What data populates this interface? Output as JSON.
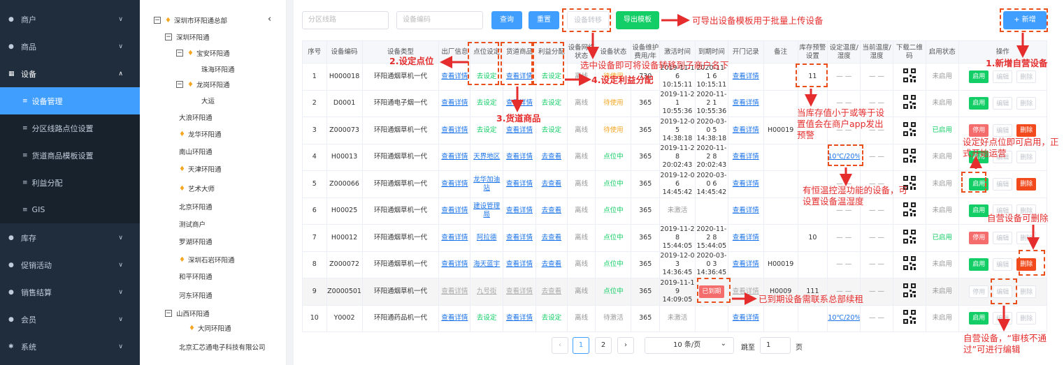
{
  "sidebar": {
    "items": [
      {
        "label": "商户",
        "icon": "merchant-icon",
        "chevron": "∨"
      },
      {
        "label": "商品",
        "icon": "goods-icon",
        "chevron": "∨"
      },
      {
        "label": "设备",
        "icon": "device-icon",
        "chevron": "∧"
      },
      {
        "label": "库存",
        "icon": "stock-icon",
        "chevron": "∨"
      },
      {
        "label": "促销活动",
        "icon": "promo-icon",
        "chevron": "∨"
      },
      {
        "label": "销售结算",
        "icon": "settlement-icon",
        "chevron": "∨"
      },
      {
        "label": "会员",
        "icon": "member-icon",
        "chevron": "∨"
      },
      {
        "label": "系统",
        "icon": "system-icon",
        "chevron": "∨"
      }
    ],
    "sub_items": [
      "设备管理",
      "分区线路点位设置",
      "货道商品模板设置",
      "利益分配",
      "GIS"
    ],
    "active_color": "#409eff",
    "bg_color": "#1f2d3d"
  },
  "tree": {
    "nodes": [
      "深圳市环阳通总部",
      "深圳环阳通",
      "宝安环阳通",
      "珠海环阳通",
      "龙岗环阳通",
      "大运",
      "大浪环阳通",
      "龙华环阳通",
      "南山环阳通",
      "天津环阳通",
      "艺术大师",
      "北京环阳通",
      "测试商户",
      "罗湖环阳通",
      "深圳石岩环阳通",
      "和平环阳通",
      "河东环阳通",
      "山西环阳通",
      "大同环阳通",
      "北京汇芯通电子科技有限公司"
    ],
    "collapse_icon": "‹"
  },
  "toolbar": {
    "zone_placeholder": "分区线路",
    "code_placeholder": "设备编码",
    "query": "查询",
    "reset": "重置",
    "transfer": "设备转移",
    "export": "导出模板",
    "add": "+ 新增"
  },
  "table": {
    "headers": [
      "序号",
      "设备编码",
      "设备类型",
      "出厂信息",
      "点位设定",
      "货道商品",
      "利益分配",
      "设备网络状态",
      "设备状态",
      "设备维护费用/年",
      "激活时间",
      "到期时间",
      "开门记录",
      "备注",
      "库存预警设置",
      "设定温度/湿度",
      "当前温度/湿度",
      "下载二维码",
      "启用状态",
      "操作"
    ],
    "rows": [
      {
        "no": "1",
        "code": "H000018",
        "type": "环阳通烟草机一代",
        "factory": "查看详情",
        "point": "去设定",
        "goods": "查看详情",
        "profit": "去设定",
        "net": "离线",
        "status": "待使用",
        "fee": "730",
        "active": "2019-11-1 6 10:15:11",
        "expire": "2020-11-1 6 10:15:11",
        "door": "查看详情",
        "note": "",
        "warn": "11",
        "settemp": "— —",
        "curtemp": "— —",
        "enabled": "未启用",
        "op1": "启用",
        "op2": "编辑",
        "op3": "删除"
      },
      {
        "no": "2",
        "code": "D0001",
        "type": "环阳通电子烟一代",
        "factory": "查看详情",
        "point": "去设定",
        "goods": "查看详情",
        "profit": "去设定",
        "net": "离线",
        "status": "待使用",
        "fee": "365",
        "active": "2019-11-2 1 10:55:36",
        "expire": "2020-11-2 1 10:55:36",
        "door": "查看详情",
        "note": "",
        "warn": "",
        "settemp": "— —",
        "curtemp": "— —",
        "enabled": "未启用",
        "op1": "启用",
        "op2": "编辑",
        "op3": "删除"
      },
      {
        "no": "3",
        "code": "Z000073",
        "type": "环阳通烟草机一代",
        "factory": "查看详情",
        "point": "去设定",
        "goods": "查看详情",
        "profit": "去设定",
        "net": "离线",
        "status": "待使用",
        "fee": "365",
        "active": "2019-12-0 5 14:38:18",
        "expire": "2020-03-0 5 14:38:18",
        "door": "查看详情",
        "note": "H00019",
        "warn": "",
        "settemp": "— —",
        "curtemp": "— —",
        "enabled": "已启用",
        "op1": "停用",
        "op2": "编辑",
        "op3": "删除"
      },
      {
        "no": "4",
        "code": "H00013",
        "type": "环阳通烟草机一代",
        "factory": "查看详情",
        "point": "天界地区",
        "goods": "查看详情",
        "profit": "去查看",
        "net": "离线",
        "status": "点位中",
        "fee": "365",
        "active": "2019-11-2 8 20:02:43",
        "expire": "2020-11-2 8 20:02:43",
        "door": "查看详情",
        "note": "",
        "warn": "",
        "settemp": "10℃/20%",
        "curtemp": "— —",
        "enabled": "未启用",
        "op1": "启用",
        "op2": "编辑",
        "op3": "删除"
      },
      {
        "no": "5",
        "code": "Z000066",
        "type": "环阳通烟草机一代",
        "factory": "查看详情",
        "point": "龙华加油站",
        "goods": "查看详情",
        "profit": "去查看",
        "net": "离线",
        "status": "点位中",
        "fee": "365",
        "active": "2019-12-0 6 14:45:42",
        "expire": "2020-03-0 6 14:45:42",
        "door": "查看详情",
        "note": "",
        "warn": "",
        "settemp": "— —",
        "curtemp": "— —",
        "enabled": "未启用",
        "op1": "启用",
        "op2": "编辑",
        "op3": "删除"
      },
      {
        "no": "6",
        "code": "H00025",
        "type": "环阳通烟草机一代",
        "factory": "查看详情",
        "point": "建设管理局",
        "goods": "查看详情",
        "profit": "去查看",
        "net": "离线",
        "status": "点位中",
        "fee": "365",
        "active": "未激活",
        "expire": "",
        "door": "查看详情",
        "note": "",
        "warn": "",
        "settemp": "— —",
        "curtemp": "— —",
        "enabled": "未启用",
        "op1": "启用",
        "op2": "编辑",
        "op3": "删除"
      },
      {
        "no": "7",
        "code": "H00012",
        "type": "环阳通烟草机一代",
        "factory": "查看详情",
        "point": "阿拉德",
        "goods": "查看详情",
        "profit": "去查看",
        "net": "离线",
        "status": "点位中",
        "fee": "365",
        "active": "2019-11-2 8 15:44:05",
        "expire": "2020-11-2 8 15:44:05",
        "door": "查看详情",
        "note": "",
        "warn": "10",
        "settemp": "— —",
        "curtemp": "— —",
        "enabled": "已启用",
        "op1": "停用",
        "op2": "编辑",
        "op3": "删除"
      },
      {
        "no": "8",
        "code": "Z000072",
        "type": "环阳通烟草机一代",
        "factory": "查看详情",
        "point": "海天蓝宇",
        "goods": "查看详情",
        "profit": "去查看",
        "net": "离线",
        "status": "点位中",
        "fee": "365",
        "active": "2019-12-0 3 14:36:45",
        "expire": "2020-03-0 3 14:36:45",
        "door": "查看详情",
        "note": "H00019",
        "warn": "",
        "settemp": "— —",
        "curtemp": "— —",
        "enabled": "未启用",
        "op1": "启用",
        "op2": "编辑",
        "op3": "删除"
      },
      {
        "no": "9",
        "code": "Z0000501",
        "type": "环阳通烟草机一代",
        "factory": "查看详情",
        "point": "九号街",
        "goods": "查看详情",
        "profit": "去查看",
        "net": "离线",
        "status": "点位中",
        "fee": "365",
        "active": "2019-11-1 9 14:09:05",
        "expire": "已到期",
        "door": "查看详情",
        "note": "H0009",
        "warn": "111",
        "settemp": "— —",
        "curtemp": "— —",
        "enabled": "未启用",
        "op1": "停用",
        "op2": "编辑",
        "op3": "删除"
      },
      {
        "no": "10",
        "code": "Y0002",
        "type": "环阳通药品机一代",
        "factory": "查看详情",
        "point": "去设定",
        "goods": "查看详情",
        "profit": "去设定",
        "net": "离线",
        "status": "待激活",
        "fee": "365",
        "active": "未激活",
        "expire": "",
        "door": "查看详情",
        "note": "",
        "warn": "",
        "settemp": "10℃/20%",
        "curtemp": "— —",
        "enabled": "未启用",
        "op1": "启用",
        "op2": "编辑",
        "op3": "删除"
      }
    ]
  },
  "pagination": {
    "prev": "‹",
    "page1": "1",
    "page2": "2",
    "next": "›",
    "size": "10 条/页",
    "size_chevron": "⌄",
    "goto_label": "跳至",
    "goto_value": "1",
    "page_suffix": "页"
  },
  "annotations": {
    "export": "可导出设备模板用于批量上传设备",
    "add": "1.新增自营设备",
    "point": "2.设定点位",
    "goods": "3.货道商品",
    "profit": "4.设定利益分配",
    "transfer": "选中设备即可将设备转移到子商户名下",
    "warn": "当库存值小于或等于设置值会在商户app发出预警",
    "enable": "设定好点位即可启用，正式开始运营",
    "temp": "有恒温控湿功能的设备，可设置设备温湿度",
    "delete": "自营设备可删除",
    "expired": "已到期设备需联系总部续租",
    "edit": "自营设备，“审核不通过”可进行编辑"
  },
  "colors": {
    "primary": "#409eff",
    "success": "#13ce66",
    "danger": "#f56c6c",
    "annotation": "#e52d2d"
  }
}
